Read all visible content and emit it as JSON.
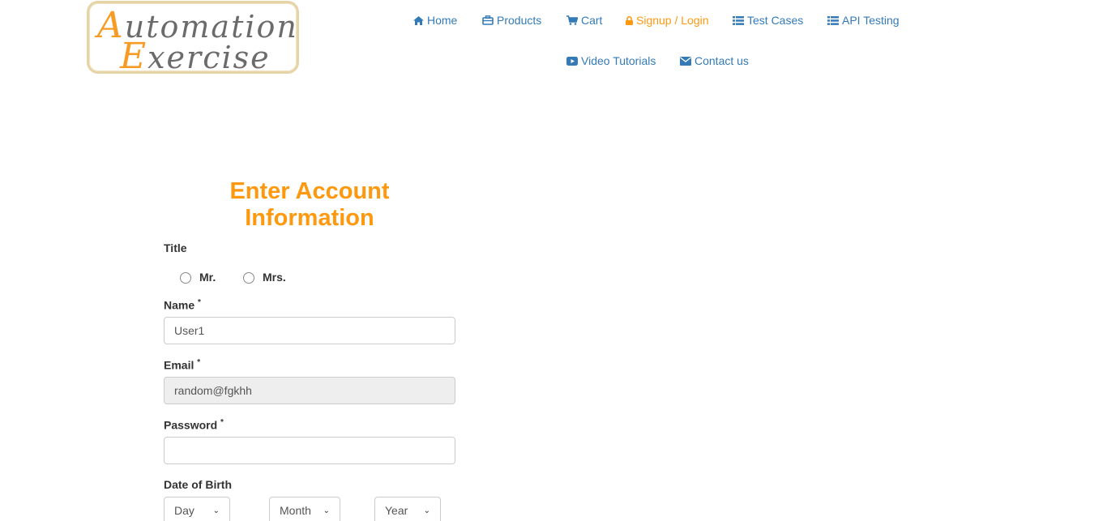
{
  "logo": {
    "line1_cap": "A",
    "line1_rest": "utomation",
    "line2_cap": "E",
    "line2_rest": "xercise"
  },
  "nav": {
    "items": [
      {
        "label": "Home",
        "icon": "home-icon"
      },
      {
        "label": "Products",
        "icon": "products-icon"
      },
      {
        "label": "Cart",
        "icon": "cart-icon"
      },
      {
        "label": "Signup / Login",
        "icon": "lock-icon",
        "active": true
      },
      {
        "label": "Test Cases",
        "icon": "list-icon"
      },
      {
        "label": "API Testing",
        "icon": "list-icon"
      },
      {
        "label": "Video Tutorials",
        "icon": "youtube-icon"
      },
      {
        "label": "Contact us",
        "icon": "envelope-icon"
      }
    ]
  },
  "form": {
    "heading": "Enter Account Information",
    "title_label": "Title",
    "title_options": [
      "Mr.",
      "Mrs."
    ],
    "name_label": "Name",
    "name_value": "User1",
    "email_label": "Email",
    "email_value": "random@fgkhh",
    "password_label": "Password",
    "password_value": "",
    "required_mark": "*",
    "dob_label": "Date of Birth",
    "dob": {
      "day": "Day",
      "month": "Month",
      "year": "Year"
    }
  },
  "colors": {
    "accent": "#fe980f",
    "link": "#337ab7",
    "input_border": "#cccccc",
    "disabled_bg": "#eeeeee"
  }
}
